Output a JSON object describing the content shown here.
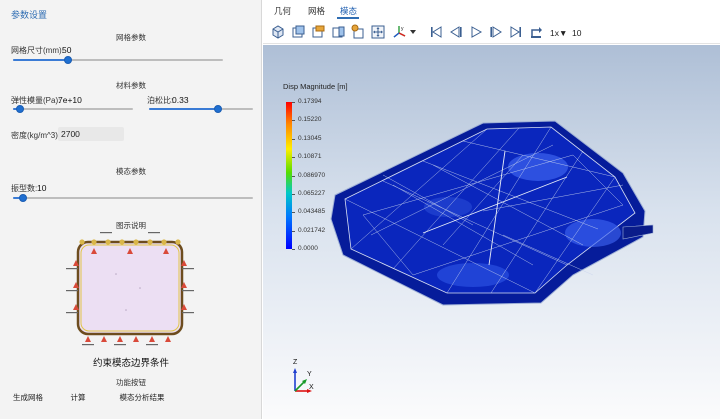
{
  "left": {
    "title": "参数设置",
    "mesh_section": "网格参数",
    "mesh_size_label": "网格尺寸(mm):",
    "mesh_size_value": "50",
    "mesh_size_level": 0.26,
    "material_section": "材料参数",
    "modulus_label": "弹性模量(Pa):",
    "modulus_value": "7e+10",
    "modulus_level": 0.06,
    "poisson_label": "泊松比:",
    "poisson_value": "0.33",
    "poisson_level": 0.66,
    "density_label": "密度(kg/m^3):",
    "density_value": "2700",
    "modal_section": "模态参数",
    "modes_label": "振型数:",
    "modes_value": "10",
    "modes_level": 0.04,
    "legend_section": "图示说明",
    "figure_caption": "约束模态边界条件",
    "buttons_section": "功能按钮",
    "buttons": [
      "生成网格",
      "计算",
      "模态分析结果"
    ]
  },
  "right": {
    "tabs": [
      "几何",
      "网格",
      "模态"
    ],
    "active_tab": "模态",
    "playback_speed": "1x▼",
    "frame_count": "10",
    "legend_title": "Disp Magnitude [m]",
    "legend_ticks": [
      "0.17394",
      "0.15220",
      "0.13045",
      "0.10871",
      "0.086970",
      "0.065227",
      "0.043485",
      "0.021742",
      "0.0000"
    ],
    "axis_labels": {
      "z": "Z",
      "y": "Y",
      "x": "X"
    }
  },
  "colors": {
    "accent": "#2f6db3",
    "model_fill": "#0a22b8",
    "panel_bg": "#f3f3f3"
  },
  "icons": [
    "cube-view-icon",
    "front-view-icon",
    "top-view-icon",
    "side-view-icon",
    "iso-view-icon",
    "fit-view-icon",
    "axes-icon",
    "first-frame-icon",
    "prev-frame-icon",
    "play-icon",
    "next-frame-icon",
    "last-frame-icon",
    "loop-icon"
  ]
}
